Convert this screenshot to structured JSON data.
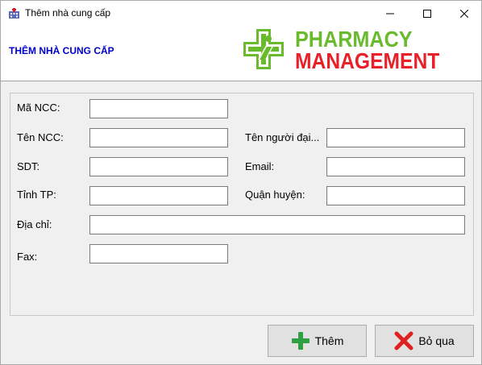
{
  "window": {
    "title": "Thêm nhà cung cấp"
  },
  "header": {
    "title": "THÊM NHÀ CUNG CẤP",
    "logo_line1": "PHARMACY",
    "logo_line2": "MANAGEMENT",
    "colors": {
      "logo_green": "#6aba2e",
      "logo_red": "#e8202a",
      "title_blue": "#0000cc"
    }
  },
  "form": {
    "ma_ncc": {
      "label": "Mã NCC:",
      "value": ""
    },
    "ten_ncc": {
      "label": "Tên NCC:",
      "value": ""
    },
    "ten_nguoi_dai_dien": {
      "label": "Tên người đại...",
      "value": ""
    },
    "sdt": {
      "label": "SDT:",
      "value": ""
    },
    "email": {
      "label": "Email:",
      "value": ""
    },
    "tinh_tp": {
      "label": "Tỉnh TP:",
      "value": ""
    },
    "quan_huyen": {
      "label": "Quận huyện:",
      "value": ""
    },
    "dia_chi": {
      "label": "Địa chỉ:",
      "value": ""
    },
    "fax": {
      "label": "Fax:",
      "value": ""
    }
  },
  "actions": {
    "add_label": "Thêm",
    "add_icon": "plus-icon",
    "skip_label": "Bỏ qua",
    "skip_icon": "x-icon"
  }
}
